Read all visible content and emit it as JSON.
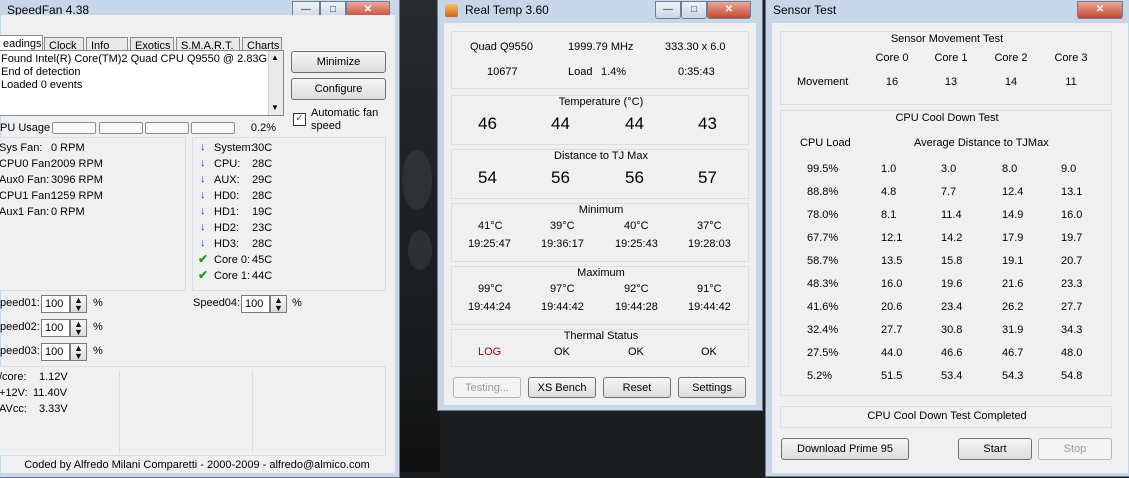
{
  "speedfan": {
    "title": "SpeedFan 4.38",
    "tabs": [
      "eadings",
      "Clock",
      "Info",
      "Exotics",
      "S.M.A.R.T.",
      "Charts"
    ],
    "log_lines": [
      "Found Intel(R) Core(TM)2 Quad CPU Q9550 @ 2.83GHz",
      "End of detection",
      "Loaded 0 events"
    ],
    "minimize_label": "Minimize",
    "configure_label": "Configure",
    "auto_fan_label_1": "Automatic fan",
    "auto_fan_label_2": "speed",
    "auto_fan_checked": true,
    "cpu_usage_label": "PU Usage",
    "cpu_usage_value": "0.2%",
    "fans": [
      {
        "name": "Sys Fan:",
        "value": "0 RPM"
      },
      {
        "name": "CPU0 Fan:",
        "value": "2009 RPM"
      },
      {
        "name": "Aux0 Fan:",
        "value": "3096 RPM"
      },
      {
        "name": "CPU1 Fan:",
        "value": "1259 RPM"
      },
      {
        "name": "Aux1 Fan:",
        "value": "0 RPM"
      }
    ],
    "temps": [
      {
        "name": "System:",
        "value": "30C",
        "icon": "arrow-down-icon"
      },
      {
        "name": "CPU:",
        "value": "28C",
        "icon": "arrow-down-icon"
      },
      {
        "name": "AUX:",
        "value": "29C",
        "icon": "arrow-down-icon"
      },
      {
        "name": "HD0:",
        "value": "28C",
        "icon": "arrow-down-icon"
      },
      {
        "name": "HD1:",
        "value": "19C",
        "icon": "arrow-down-icon"
      },
      {
        "name": "HD2:",
        "value": "23C",
        "icon": "arrow-down-icon"
      },
      {
        "name": "HD3:",
        "value": "28C",
        "icon": "arrow-down-icon"
      },
      {
        "name": "Core 0:",
        "value": "45C",
        "icon": "check-icon"
      },
      {
        "name": "Core 1:",
        "value": "44C",
        "icon": "check-icon"
      }
    ],
    "speeds": [
      {
        "name": "peed01:",
        "value": "100",
        "unit": "%"
      },
      {
        "name": "peed02:",
        "value": "100",
        "unit": "%"
      },
      {
        "name": "peed03:",
        "value": "100",
        "unit": "%"
      },
      {
        "name": "Speed04:",
        "value": "100",
        "unit": "%"
      }
    ],
    "voltages": [
      {
        "name": "/core:",
        "value": "1.12V"
      },
      {
        "name": "+12V:",
        "value": "11.40V"
      },
      {
        "name": "AVcc:",
        "value": "3.33V"
      }
    ],
    "footer": "Coded by Alfredo Milani Comparetti - 2000-2009 - alfredo@almico.com"
  },
  "realtemp": {
    "title": "Real Temp 3.60",
    "cpu_model": "Quad Q9550",
    "cpu_mhz": "1999.79 MHz",
    "cpu_multi": "333.30 x 6.0",
    "vid": "10677",
    "load_label": "Load",
    "load_value": "1.4%",
    "uptime": "0:35:43",
    "temp_title": "Temperature (°C)",
    "temps": [
      "46",
      "44",
      "44",
      "43"
    ],
    "dist_title": "Distance to TJ Max",
    "dist": [
      "54",
      "56",
      "56",
      "57"
    ],
    "min_title": "Minimum",
    "min_temps": [
      "41°C",
      "39°C",
      "40°C",
      "37°C"
    ],
    "min_times": [
      "19:25:47",
      "19:36:17",
      "19:25:43",
      "19:28:03"
    ],
    "max_title": "Maximum",
    "max_temps": [
      "99°C",
      "97°C",
      "92°C",
      "91°C"
    ],
    "max_times": [
      "19:44:24",
      "19:44:42",
      "19:44:28",
      "19:44:42"
    ],
    "thermal_title": "Thermal Status",
    "thermal": [
      "LOG",
      "OK",
      "OK",
      "OK"
    ],
    "log_color": "#b00000",
    "testing_label": "Testing...",
    "xsbench_label": "XS Bench",
    "reset_label": "Reset",
    "settings_label": "Settings"
  },
  "sensortest": {
    "title": "Sensor Test",
    "movement_title": "Sensor Movement Test",
    "cores": [
      "Core 0",
      "Core 1",
      "Core 2",
      "Core 3"
    ],
    "movement_label": "Movement",
    "movement": [
      "16",
      "13",
      "14",
      "11"
    ],
    "cooldown_title": "CPU Cool Down Test",
    "cpu_load_header": "CPU Load",
    "avg_dist_header": "Average Distance to TJMax",
    "rows": [
      {
        "load": "99.5%",
        "v": [
          "1.0",
          "3.0",
          "8.0",
          "9.0"
        ]
      },
      {
        "load": "88.8%",
        "v": [
          "4.8",
          "7.7",
          "12.4",
          "13.1"
        ]
      },
      {
        "load": "78.0%",
        "v": [
          "8.1",
          "11.4",
          "14.9",
          "16.0"
        ]
      },
      {
        "load": "67.7%",
        "v": [
          "12.1",
          "14.2",
          "17.9",
          "19.7"
        ]
      },
      {
        "load": "58.7%",
        "v": [
          "13.5",
          "15.8",
          "19.1",
          "20.7"
        ]
      },
      {
        "load": "48.3%",
        "v": [
          "16.0",
          "19.6",
          "21.6",
          "23.3"
        ]
      },
      {
        "load": "41.6%",
        "v": [
          "20.6",
          "23.4",
          "26.2",
          "27.7"
        ]
      },
      {
        "load": "32.4%",
        "v": [
          "27.7",
          "30.8",
          "31.9",
          "34.3"
        ]
      },
      {
        "load": "27.5%",
        "v": [
          "44.0",
          "46.6",
          "46.7",
          "48.0"
        ]
      },
      {
        "load": "5.2%",
        "v": [
          "51.5",
          "53.4",
          "54.3",
          "54.8"
        ]
      }
    ],
    "status": "CPU Cool Down Test Completed",
    "download_label": "Download Prime 95",
    "start_label": "Start",
    "stop_label": "Stop"
  }
}
